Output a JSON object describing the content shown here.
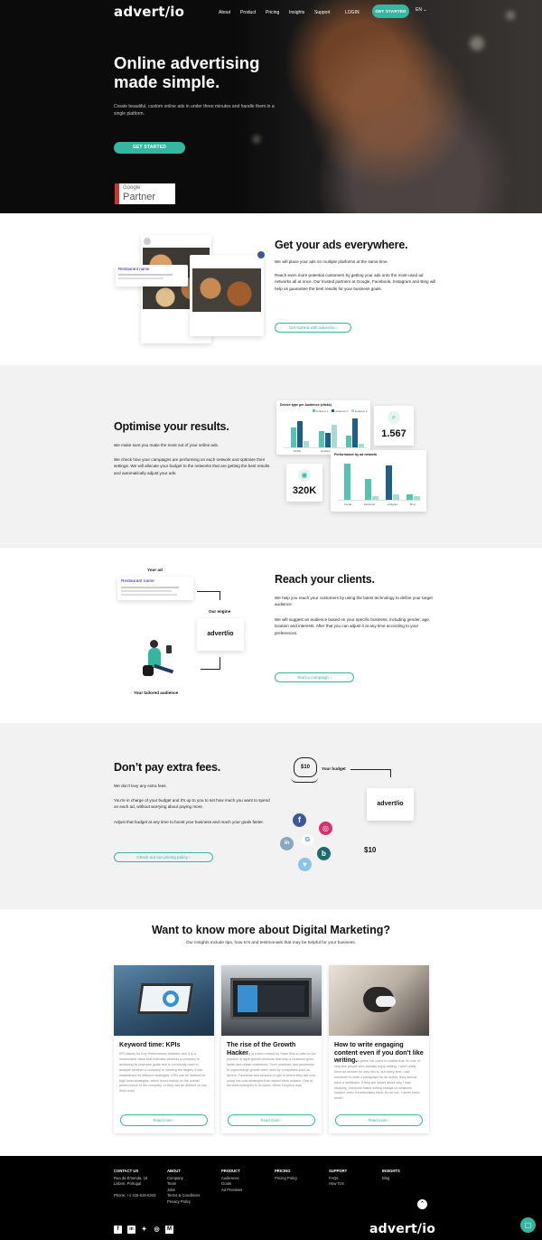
{
  "brand": "advert/io",
  "nav": {
    "items": [
      "About",
      "Product",
      "Pricing",
      "Insights",
      "Support"
    ],
    "login": "LOGIN",
    "cta": "GET STARTED",
    "lang": "EN"
  },
  "hero": {
    "title": "Online advertising made simple.",
    "subtitle": "Create beautiful, custom online ads in under three minutes and handle them in a single platform.",
    "cta": "GET STARTED",
    "partner_google": "Google",
    "partner_label": "Partner"
  },
  "everywhere": {
    "title": "Get your ads everywhere.",
    "p1": "We will place your ads on multiple platforms at the same time.",
    "p2": "Reach even more potential customers by getting your ads onto the most-used ad networks all at once. Our trusted partners at Google, Facebook, Instagram and Bing will help us guarantee the best results for your business goals.",
    "cta": "Get started with advert/io ›",
    "ad_restaurant": "Restaurant name",
    "ad_sponsored": "Sponsored",
    "ad_caption": "Jump into the delicious"
  },
  "optimise": {
    "title": "Optimise your results.",
    "p1": "We make sure you make the most out of your online ads.",
    "p2": "We check how your campaigns are performing on each network and optimise their settings. We will allocate your budget to the networks that are getting the best results and automatically adjust your ads.",
    "card1_title": "Device type per Audience (clicks)",
    "card1_legend": [
      "audience 1",
      "audience 2",
      "audience 3"
    ],
    "card1_categories": [
      "Mobile",
      "Desktop",
      "Tablet"
    ],
    "card1_values": [
      [
        60,
        80,
        20
      ],
      [
        50,
        45,
        70
      ],
      [
        35,
        90,
        10
      ]
    ],
    "metric_clicks": "1.567",
    "metric_views": "320K",
    "card2_title": "Performance by ad network",
    "card2_categories": [
      "Google",
      "Facebook",
      "Instagram",
      "Bing"
    ],
    "card2_values": [
      [
        95,
        0
      ],
      [
        55,
        10
      ],
      [
        90,
        15
      ],
      [
        15,
        10
      ]
    ],
    "colors": {
      "teal": "#58c2b0",
      "navy": "#1f5e86",
      "light_teal": "#a6dcd2",
      "accent": "#35b6a0"
    }
  },
  "reach": {
    "title": "Reach your clients.",
    "p1": "We help you reach your customers by using the latest technology to define your target audience.",
    "p2": "We will suggest an audience based on your specific business, including gender, age, location and interests. After that you can adjust it at any time according to your preferences.",
    "cta": "Start a campaign ›",
    "label_ad": "Your ad",
    "label_engine": "Our engine",
    "label_audience": "Your tailored audience",
    "ad_restaurant": "Restaurant name",
    "engine_logo": "advert/io"
  },
  "fees": {
    "title": "Don’t pay extra fees.",
    "p1": "We don't levy any extra fees.",
    "p2": "You're in charge of your budget and it's up to you to set how much you want to spend on each ad, without worrying about paying more.",
    "p3": "Adjust that budget at any time to boost your business and reach your goals faster.",
    "cta": "Check out our pricing policy ›",
    "label_budget": "Your budget",
    "bag_amount": "$10",
    "amount": "$10",
    "engine_logo": "advert/io"
  },
  "insights": {
    "title": "Want to know more about Digital Marketing?",
    "subtitle": "Our insights include tips, how to's and testimonials that may be helpful for your business.",
    "posts": [
      {
        "title": "Keyword time: KPIs",
        "excerpt": "KPI stands for Key Performance Indicator and it is a measurable value that indicates whether a company is achieving its business goals and is commonly used to analyse whether a company is meeting the targets it has established for different strategies. KPIs can be defined for high level strategies, which focus mainly on the overall performance of the company, or they can be defined on low level ones",
        "cta": "Read more ›"
      },
      {
        "title": "The rise of the Growth Hacker",
        "excerpt": "Growth Hacking is a term coined by Sean Ellis to refer to the practice of agile growth methods that help a business grow faster and obtain customers. Such practices and processes to supercharge growth were used by companies such as Airbnb, Facebook and Amazon to get to where they are now, using low-cost strategies that helped them expand. One of the best examples is Dropbox. When Dropbox was",
        "cta": "Read more ›"
      },
      {
        "title": "How to write engaging content even if you don't like writing.",
        "excerpt": "Over the last few years I've come to realise that I'm one of very few people who actually enjoy writing. I don't really have an answer for why this is, but every time I ask someone to write a paragraph for an article, they almost have a meltdown. If they are asked about why I was studying, everyone hated writing essays on whatever subject, even if it interested them. As for me, I never knew what I",
        "cta": "Read more ›"
      }
    ]
  },
  "footer": {
    "columns": [
      {
        "heading": "CONTACT US",
        "links": [
          "Rua da Emenda, 19",
          "Lisbon, Portugal",
          "",
          "Phone: +1 415-518-5343"
        ]
      },
      {
        "heading": "ABOUT",
        "links": [
          "Company",
          "Team",
          "Jobs",
          "Terms & Conditions",
          "Privacy Policy"
        ]
      },
      {
        "heading": "PRODUCT",
        "links": [
          "Audiences",
          "Goals",
          "Ad Previews"
        ]
      },
      {
        "heading": "PRICING",
        "links": [
          "Pricing Policy"
        ]
      },
      {
        "heading": "SUPPORT",
        "links": [
          "FAQs",
          "How To's"
        ]
      },
      {
        "heading": "INSIGHTS",
        "links": [
          "Blog"
        ]
      }
    ],
    "social": [
      "facebook-icon",
      "linkedin-icon",
      "twitter-icon",
      "instagram-icon",
      "medium-icon"
    ],
    "logo": "advert/io"
  }
}
